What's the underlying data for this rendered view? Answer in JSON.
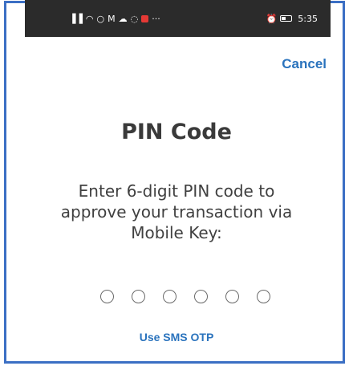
{
  "status_bar": {
    "left_icons": [
      "signal-icon",
      "wifi-icon",
      "whatsapp-icon",
      "app-m-icon",
      "cloud-icon",
      "messenger-icon",
      "record-icon",
      "more-icon"
    ],
    "left_glyphs": [
      "▐▐",
      "◠",
      "○",
      "M",
      "☁",
      "◌",
      "",
      "···"
    ],
    "alarm_glyph": "⏰",
    "time": "5:35"
  },
  "cancel_label": "Cancel",
  "title": "PIN Code",
  "instructions": "Enter 6-digit PIN code to approve your transaction via Mobile Key:",
  "pin": {
    "length": 6,
    "entered": 0
  },
  "sms_link_label": "Use SMS OTP",
  "colors": {
    "accent": "#2a73bd",
    "frame_border": "#3b6fc4",
    "status_bar_bg": "#2b2b2b"
  }
}
